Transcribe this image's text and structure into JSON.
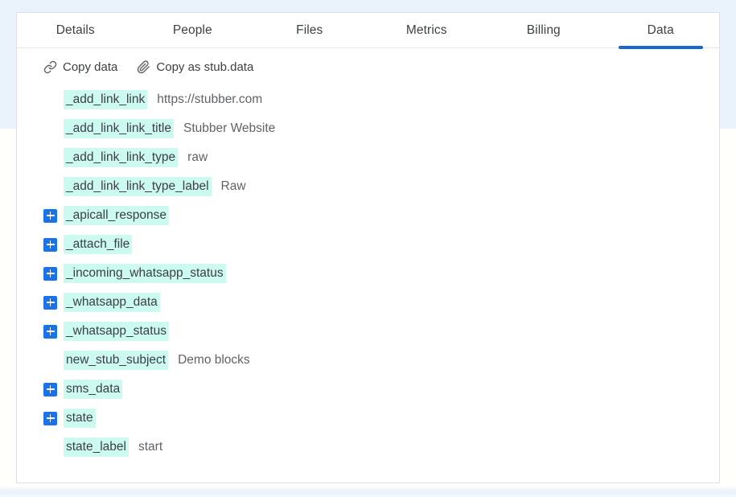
{
  "colors": {
    "accent_blue": "#1967d2",
    "expander_blue": "#1a73e8",
    "key_highlight": "#ccfaf1",
    "value_text": "#5f6368",
    "page_top_band": "#eaf3fb",
    "page_mid_band": "#fffffb",
    "card_border": "#dcdfe3"
  },
  "tabs": [
    {
      "label": "Details",
      "name": "tab-details",
      "active": false
    },
    {
      "label": "People",
      "name": "tab-people",
      "active": false
    },
    {
      "label": "Files",
      "name": "tab-files",
      "active": false
    },
    {
      "label": "Metrics",
      "name": "tab-metrics",
      "active": false
    },
    {
      "label": "Billing",
      "name": "tab-billing",
      "active": false
    },
    {
      "label": "Data",
      "name": "tab-data",
      "active": true
    }
  ],
  "toolbar": {
    "copy_data_label": "Copy data",
    "copy_data_icon": "link-icon",
    "copy_stub_label": "Copy as stub.data",
    "copy_stub_icon": "paperclip-icon"
  },
  "data_rows": [
    {
      "key": "_add_link_link",
      "value": "https://stubber.com",
      "expandable": false
    },
    {
      "key": "_add_link_link_title",
      "value": "Stubber Website",
      "expandable": false
    },
    {
      "key": "_add_link_link_type",
      "value": "raw",
      "expandable": false
    },
    {
      "key": "_add_link_link_type_label",
      "value": "Raw",
      "expandable": false
    },
    {
      "key": "_apicall_response",
      "value": "",
      "expandable": true
    },
    {
      "key": "_attach_file",
      "value": "",
      "expandable": true
    },
    {
      "key": "_incoming_whatsapp_status",
      "value": "",
      "expandable": true
    },
    {
      "key": "_whatsapp_data",
      "value": "",
      "expandable": true
    },
    {
      "key": "_whatsapp_status",
      "value": "",
      "expandable": true
    },
    {
      "key": "new_stub_subject",
      "value": "Demo blocks",
      "expandable": false
    },
    {
      "key": "sms_data",
      "value": "",
      "expandable": true
    },
    {
      "key": "state",
      "value": "",
      "expandable": true
    },
    {
      "key": "state_label",
      "value": "start",
      "expandable": false
    }
  ]
}
